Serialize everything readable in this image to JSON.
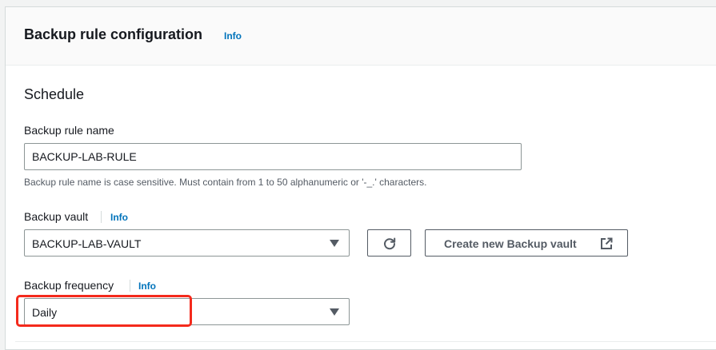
{
  "panel": {
    "title": "Backup rule configuration",
    "info_label": "Info"
  },
  "schedule": {
    "title": "Schedule"
  },
  "rule_name": {
    "label": "Backup rule name",
    "value": "BACKUP-LAB-RULE",
    "hint": "Backup rule name is case sensitive. Must contain from 1 to 50 alphanumeric or '-_.' characters."
  },
  "vault": {
    "label": "Backup vault",
    "info_label": "Info",
    "selected": "BACKUP-LAB-VAULT",
    "refresh_icon": "refresh-icon",
    "create_label": "Create new Backup vault",
    "create_icon": "external-link-icon"
  },
  "frequency": {
    "label": "Backup frequency",
    "info_label": "Info",
    "selected": "Daily"
  },
  "colors": {
    "accent_link": "#0073bb",
    "highlight": "#f42a1c",
    "border": "#8d9696"
  }
}
